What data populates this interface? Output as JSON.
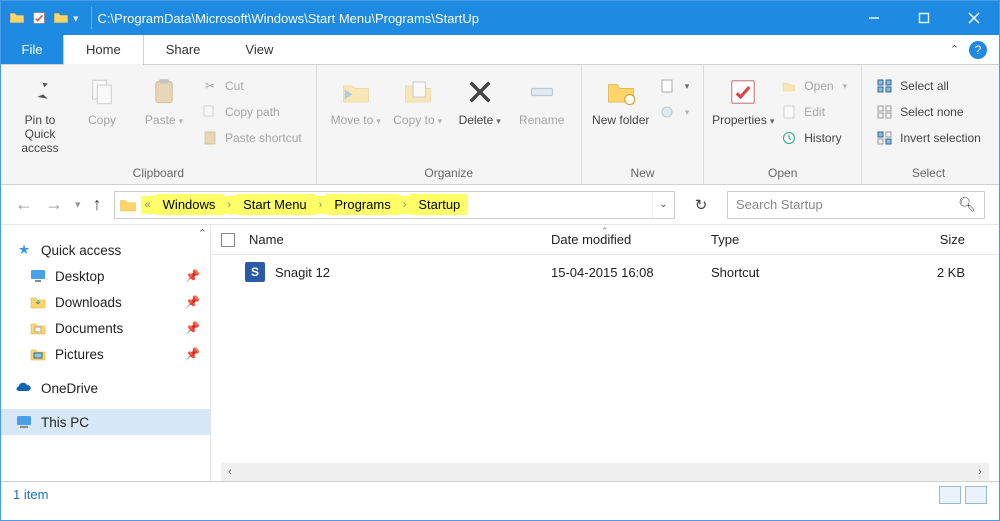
{
  "titlebar": {
    "path": "C:\\ProgramData\\Microsoft\\Windows\\Start Menu\\Programs\\StartUp"
  },
  "tabs": {
    "file": "File",
    "home": "Home",
    "share": "Share",
    "view": "View"
  },
  "ribbon": {
    "clipboard": {
      "label": "Clipboard",
      "pin": "Pin to Quick access",
      "copy": "Copy",
      "paste": "Paste",
      "cut": "Cut",
      "copypath": "Copy path",
      "pastesc": "Paste shortcut"
    },
    "organize": {
      "label": "Organize",
      "moveto": "Move to",
      "copyto": "Copy to",
      "delete": "Delete",
      "rename": "Rename"
    },
    "new": {
      "label": "New",
      "newfolder": "New folder"
    },
    "open": {
      "label": "Open",
      "properties": "Properties",
      "open": "Open",
      "edit": "Edit",
      "history": "History"
    },
    "select": {
      "label": "Select",
      "all": "Select all",
      "none": "Select none",
      "invert": "Invert selection"
    }
  },
  "breadcrumbs": {
    "items": [
      "Windows",
      "Start Menu",
      "Programs",
      "Startup"
    ]
  },
  "search": {
    "placeholder": "Search Startup"
  },
  "sidebar": {
    "quick": "Quick access",
    "desktop": "Desktop",
    "downloads": "Downloads",
    "documents": "Documents",
    "pictures": "Pictures",
    "onedrive": "OneDrive",
    "thispc": "This PC"
  },
  "columns": {
    "name": "Name",
    "date": "Date modified",
    "type": "Type",
    "size": "Size"
  },
  "rows": [
    {
      "name": "Snagit 12",
      "date": "15-04-2015 16:08",
      "type": "Shortcut",
      "size": "2 KB"
    }
  ],
  "status": {
    "count": "1 item"
  }
}
